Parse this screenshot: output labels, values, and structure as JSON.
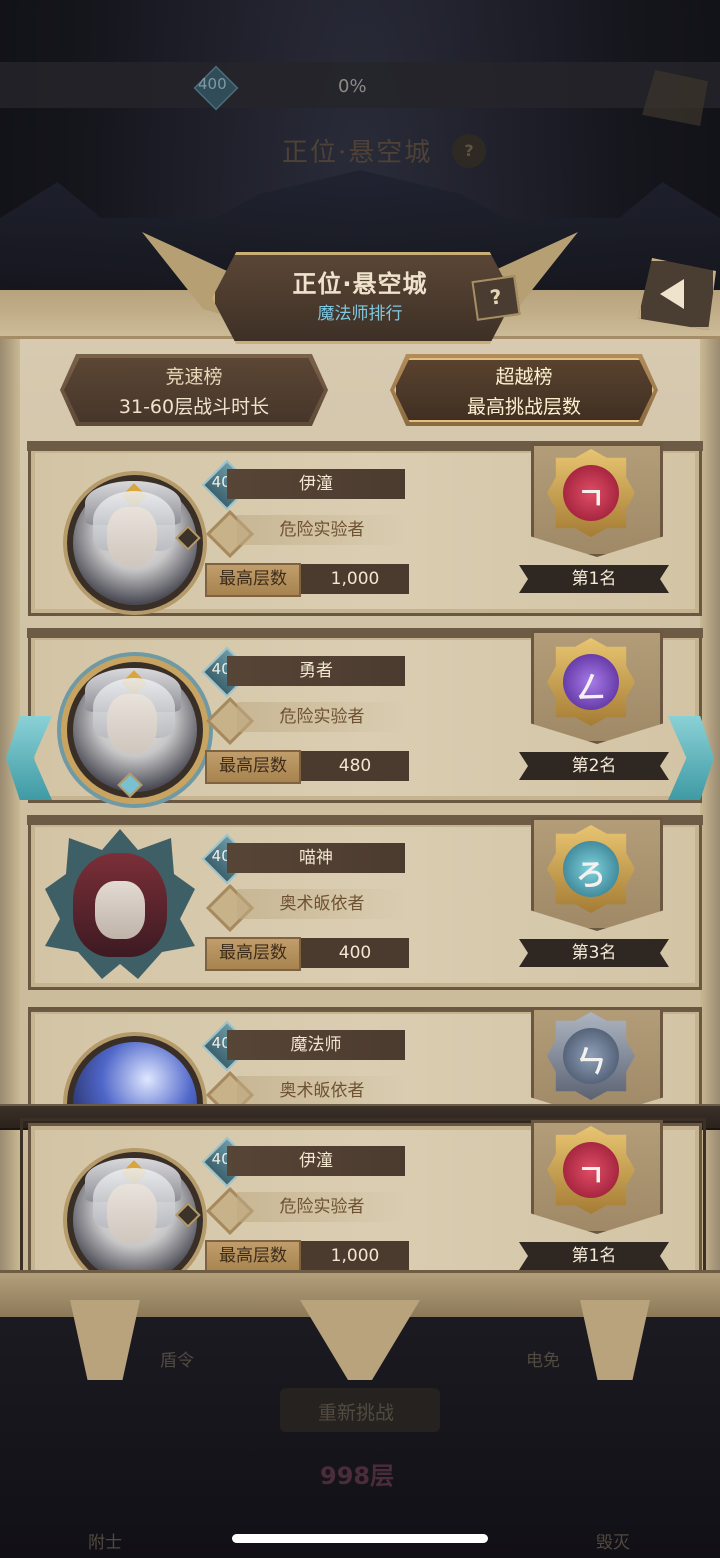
{
  "background": {
    "level": "400",
    "progress": "0%",
    "title": "正位·悬空城",
    "help": "?",
    "labels": {
      "left": "盾令",
      "right": "电免",
      "retry": "重新挑战",
      "floor": "998层",
      "bottom_left": "附士",
      "bottom_right": "毁灭"
    }
  },
  "dialog": {
    "title": "正位·悬空城",
    "subtitle": "魔法师排行",
    "help": "?",
    "tabs": [
      {
        "name": "竞速榜",
        "desc": "31-60层战斗时长",
        "selected": false
      },
      {
        "name": "超越榜",
        "desc": "最高挑战层数",
        "selected": true
      }
    ],
    "floor_label": "最高层数",
    "rows": [
      {
        "level": "400",
        "name": "伊潼",
        "class": "危险实验者",
        "floor": "1,000",
        "rank": "第1名",
        "emblem_color": "#b0243b"
      },
      {
        "level": "400",
        "name": "勇者",
        "class": "危险实验者",
        "floor": "480",
        "rank": "第2名",
        "emblem_color": "#6b3ab8"
      },
      {
        "level": "400",
        "name": "喵神",
        "class": "奥术皈依者",
        "floor": "400",
        "rank": "第3名",
        "emblem_color": "#2f8fa4"
      },
      {
        "level": "400",
        "name": "魔法师",
        "class": "奥术皈依者",
        "floor": "",
        "rank": "",
        "emblem_color": "#55647a"
      }
    ],
    "self_row": {
      "level": "400",
      "name": "伊潼",
      "class": "危险实验者",
      "floor": "1,000",
      "rank": "第1名",
      "emblem_color": "#b0243b"
    }
  },
  "colors": {
    "accent_teal": "#7fc8e2",
    "parchment": "#d3c4a5",
    "dark_bar": "#4b3b2f"
  }
}
